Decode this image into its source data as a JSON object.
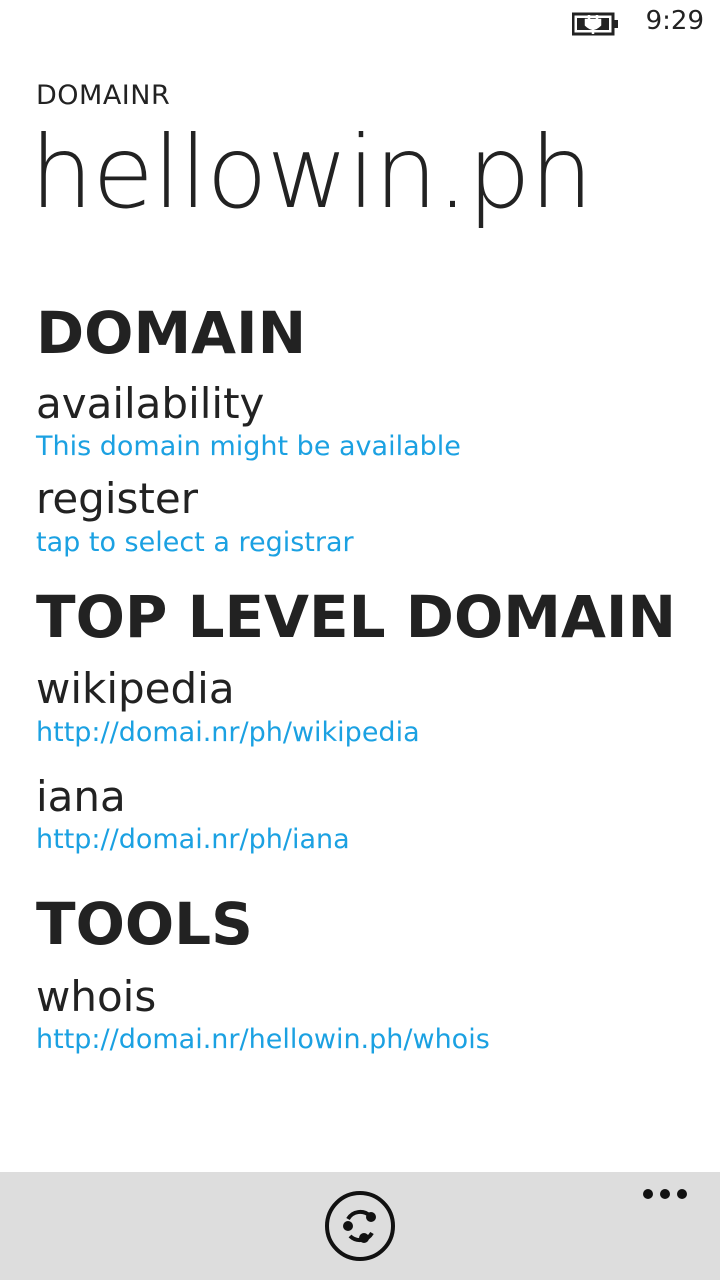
{
  "status_bar": {
    "time": "9:29",
    "battery_icon": "battery-charging-icon"
  },
  "app": {
    "name": "DOMAINR",
    "title": "hellowin.ph"
  },
  "sections": [
    {
      "header": "DOMAIN",
      "items": [
        {
          "title": "availability",
          "link": "This domain might be available"
        },
        {
          "title": "register",
          "link": "tap to select a registrar"
        }
      ]
    },
    {
      "header": "TOP LEVEL DOMAIN",
      "items": [
        {
          "title": "wikipedia",
          "link": "http://domai.nr/ph/wikipedia"
        },
        {
          "title": "iana",
          "link": "http://domai.nr/ph/iana"
        }
      ]
    },
    {
      "header": "TOOLS",
      "items": [
        {
          "title": "whois",
          "link": "http://domai.nr/hellowin.ph/whois"
        }
      ]
    }
  ],
  "app_bar": {
    "primary_icon": "refresh-icon",
    "more_icon": "more-options-icon"
  },
  "colors": {
    "accent": "#1ba1e2",
    "text": "#222222",
    "app_bar_bg": "#dddddd"
  }
}
